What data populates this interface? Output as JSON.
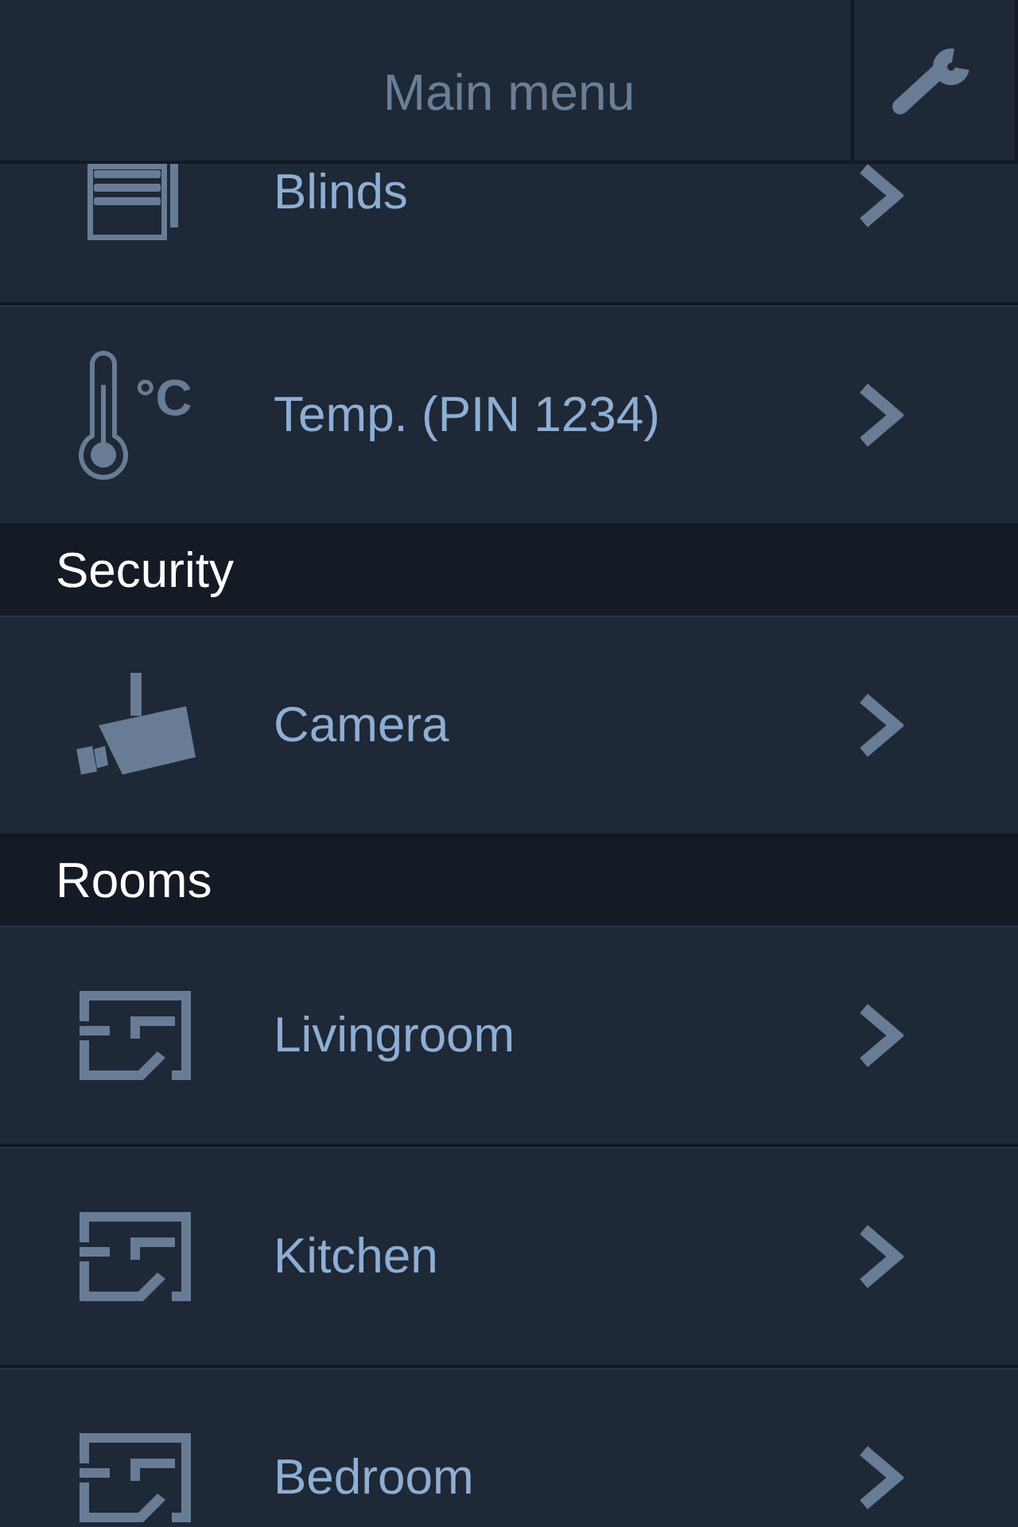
{
  "header": {
    "title": "Main menu"
  },
  "groups": [
    {
      "items": [
        {
          "kind": "blinds",
          "label": "Blinds"
        },
        {
          "kind": "temperature",
          "label": "Temp. (PIN 1234)",
          "unit": "°C"
        }
      ]
    },
    {
      "heading": "Security",
      "items": [
        {
          "kind": "camera",
          "label": "Camera"
        }
      ]
    },
    {
      "heading": "Rooms",
      "items": [
        {
          "kind": "room",
          "label": "Livingroom"
        },
        {
          "kind": "room",
          "label": "Kitchen"
        },
        {
          "kind": "room",
          "label": "Bedroom"
        }
      ]
    }
  ]
}
